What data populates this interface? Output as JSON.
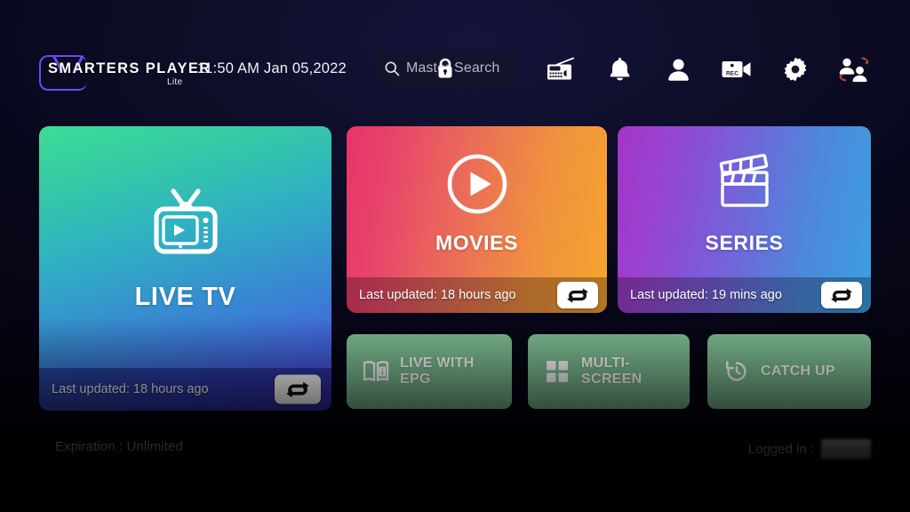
{
  "app": {
    "name": "Smarters Player",
    "brand": {
      "name": "SMARTERS PLAYER",
      "sub": "Lite",
      "accent": "#6d4bf0"
    }
  },
  "header": {
    "time": "11:50 AM",
    "date": "Jan 05,2022",
    "datetime": "11:50 AM  Jan 05,2022",
    "search": {
      "placeholder": "Master Search",
      "value": "",
      "icon": "search-icon",
      "locked": true,
      "lock_icon": "lock-icon"
    },
    "icons": [
      {
        "name": "radio-icon",
        "label": "Radio"
      },
      {
        "name": "bell-icon",
        "label": "Notifications"
      },
      {
        "name": "person-icon",
        "label": "Account"
      },
      {
        "name": "rec-camera-icon",
        "label": "Recordings"
      },
      {
        "name": "gear-icon",
        "label": "Settings"
      },
      {
        "name": "switch-user-icon",
        "label": "Switch User"
      }
    ]
  },
  "tiles": {
    "livetv": {
      "title": "LIVE TV",
      "icon": "tv-icon",
      "last_updated": "Last updated: 18 hours ago",
      "refresh_icon": "refresh-loop-icon",
      "colors": {
        "from": "#3ddc97",
        "to": "#4b46d8"
      }
    },
    "movies": {
      "title": "MOVIES",
      "icon": "play-circle-icon",
      "last_updated": "Last updated: 18 hours ago",
      "refresh_icon": "refresh-loop-icon",
      "colors": {
        "from": "#e8336b",
        "to": "#f5a42e"
      }
    },
    "series": {
      "title": "SERIES",
      "icon": "clapperboard-icon",
      "last_updated": "Last updated: 19 mins ago",
      "refresh_icon": "refresh-loop-icon",
      "colors": {
        "from": "#a335c9",
        "to": "#3aa0e0"
      }
    }
  },
  "actions": {
    "accent": "#7cbc91",
    "items": [
      {
        "label_line1": "LIVE WITH",
        "label_line2": "EPG",
        "icon": "epg-book-icon"
      },
      {
        "label_line1": "MULTI-SCREEN",
        "label_line2": "",
        "icon": "grid-squares-icon"
      },
      {
        "label_line1": "CATCH UP",
        "label_line2": "",
        "icon": "history-clock-icon"
      }
    ]
  },
  "footer": {
    "expiration": "Expiration : Unlimited",
    "logged_in_label": "Logged in :",
    "logged_in_value_redacted": true
  }
}
